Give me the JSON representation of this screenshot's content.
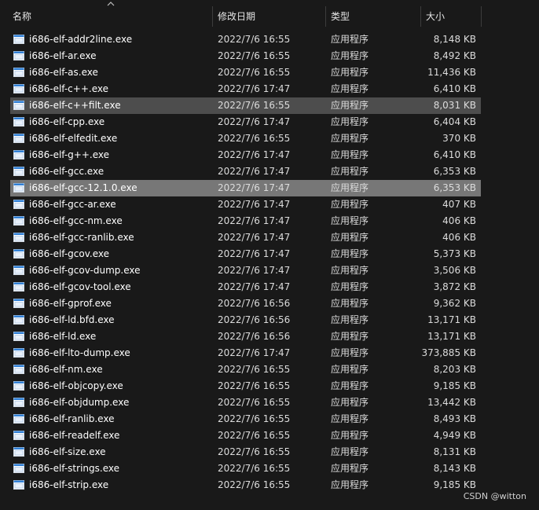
{
  "columns": {
    "name": "名称",
    "date": "修改日期",
    "type": "类型",
    "size": "大小"
  },
  "sort": {
    "column": "name",
    "direction": "ascending",
    "icon": "chevron-up-icon"
  },
  "file_icon": "exe-window-icon",
  "files": [
    {
      "name": "i686-elf-addr2line.exe",
      "date": "2022/7/6 16:55",
      "type": "应用程序",
      "size": "8,148 KB"
    },
    {
      "name": "i686-elf-ar.exe",
      "date": "2022/7/6 16:55",
      "type": "应用程序",
      "size": "8,492 KB"
    },
    {
      "name": "i686-elf-as.exe",
      "date": "2022/7/6 16:55",
      "type": "应用程序",
      "size": "11,436 KB"
    },
    {
      "name": "i686-elf-c++.exe",
      "date": "2022/7/6 17:47",
      "type": "应用程序",
      "size": "6,410 KB"
    },
    {
      "name": "i686-elf-c++filt.exe",
      "date": "2022/7/6 16:55",
      "type": "应用程序",
      "size": "8,031 KB",
      "state": "hover"
    },
    {
      "name": "i686-elf-cpp.exe",
      "date": "2022/7/6 17:47",
      "type": "应用程序",
      "size": "6,404 KB"
    },
    {
      "name": "i686-elf-elfedit.exe",
      "date": "2022/7/6 16:55",
      "type": "应用程序",
      "size": "370 KB"
    },
    {
      "name": "i686-elf-g++.exe",
      "date": "2022/7/6 17:47",
      "type": "应用程序",
      "size": "6,410 KB"
    },
    {
      "name": "i686-elf-gcc.exe",
      "date": "2022/7/6 17:47",
      "type": "应用程序",
      "size": "6,353 KB"
    },
    {
      "name": "i686-elf-gcc-12.1.0.exe",
      "date": "2022/7/6 17:47",
      "type": "应用程序",
      "size": "6,353 KB",
      "state": "selected"
    },
    {
      "name": "i686-elf-gcc-ar.exe",
      "date": "2022/7/6 17:47",
      "type": "应用程序",
      "size": "407 KB"
    },
    {
      "name": "i686-elf-gcc-nm.exe",
      "date": "2022/7/6 17:47",
      "type": "应用程序",
      "size": "406 KB"
    },
    {
      "name": "i686-elf-gcc-ranlib.exe",
      "date": "2022/7/6 17:47",
      "type": "应用程序",
      "size": "406 KB"
    },
    {
      "name": "i686-elf-gcov.exe",
      "date": "2022/7/6 17:47",
      "type": "应用程序",
      "size": "5,373 KB"
    },
    {
      "name": "i686-elf-gcov-dump.exe",
      "date": "2022/7/6 17:47",
      "type": "应用程序",
      "size": "3,506 KB"
    },
    {
      "name": "i686-elf-gcov-tool.exe",
      "date": "2022/7/6 17:47",
      "type": "应用程序",
      "size": "3,872 KB"
    },
    {
      "name": "i686-elf-gprof.exe",
      "date": "2022/7/6 16:56",
      "type": "应用程序",
      "size": "9,362 KB"
    },
    {
      "name": "i686-elf-ld.bfd.exe",
      "date": "2022/7/6 16:56",
      "type": "应用程序",
      "size": "13,171 KB"
    },
    {
      "name": "i686-elf-ld.exe",
      "date": "2022/7/6 16:56",
      "type": "应用程序",
      "size": "13,171 KB"
    },
    {
      "name": "i686-elf-lto-dump.exe",
      "date": "2022/7/6 17:47",
      "type": "应用程序",
      "size": "373,885 KB"
    },
    {
      "name": "i686-elf-nm.exe",
      "date": "2022/7/6 16:55",
      "type": "应用程序",
      "size": "8,203 KB"
    },
    {
      "name": "i686-elf-objcopy.exe",
      "date": "2022/7/6 16:55",
      "type": "应用程序",
      "size": "9,185 KB"
    },
    {
      "name": "i686-elf-objdump.exe",
      "date": "2022/7/6 16:55",
      "type": "应用程序",
      "size": "13,442 KB"
    },
    {
      "name": "i686-elf-ranlib.exe",
      "date": "2022/7/6 16:55",
      "type": "应用程序",
      "size": "8,493 KB"
    },
    {
      "name": "i686-elf-readelf.exe",
      "date": "2022/7/6 16:55",
      "type": "应用程序",
      "size": "4,949 KB"
    },
    {
      "name": "i686-elf-size.exe",
      "date": "2022/7/6 16:55",
      "type": "应用程序",
      "size": "8,131 KB"
    },
    {
      "name": "i686-elf-strings.exe",
      "date": "2022/7/6 16:55",
      "type": "应用程序",
      "size": "8,143 KB"
    },
    {
      "name": "i686-elf-strip.exe",
      "date": "2022/7/6 16:55",
      "type": "应用程序",
      "size": "9,185 KB"
    }
  ],
  "watermark": "CSDN @witton",
  "colors": {
    "background": "#191919",
    "hover_row": "#4d4d4d",
    "selected_row": "#777777",
    "icon_blue": "#2f7fd6"
  }
}
